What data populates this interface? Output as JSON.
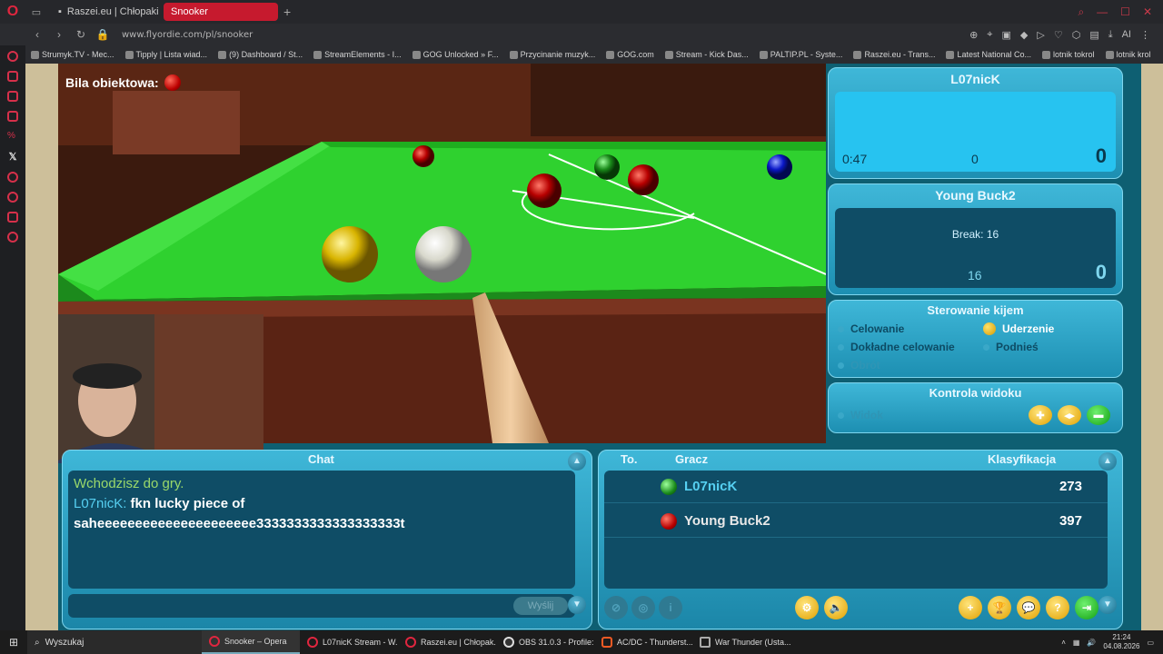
{
  "browser": {
    "tabs": [
      {
        "label": "Raszei.eu | Chłopaki z Raszei",
        "active": false
      },
      {
        "label": "Snooker",
        "active": true
      }
    ],
    "url": "www.flyordie.com/pl/snooker",
    "ai_label": "AI",
    "bookmarks": [
      "Strumyk.TV - Mec...",
      "Tipply | Lista wiad...",
      "(9) Dashboard / St...",
      "StreamElements - I...",
      "GOG Unlocked » F...",
      "Przycinanie muzyk...",
      "GOG.com",
      "Stream - Kick Das...",
      "PALTIP.PL - Syste...",
      "Raszei.eu - Trans...",
      "Latest National Co...",
      "lotnik tokrol",
      "lotnik krol"
    ]
  },
  "game": {
    "object_ball_label": "Bila obiektowa:",
    "players": [
      {
        "name": "L07nicK",
        "time": "0:47",
        "break_pts": "0",
        "score": "0",
        "break_text": ""
      },
      {
        "name": "Young Buck2",
        "time": "",
        "break_pts": "16",
        "score": "0",
        "break_text": "Break: 16"
      }
    ],
    "cue_control": {
      "title": "Sterowanie kijem",
      "options": [
        {
          "label": "Celowanie",
          "state": "normal"
        },
        {
          "label": "Uderzenie",
          "state": "selected"
        },
        {
          "label": "Dokładne celowanie",
          "state": "normal"
        },
        {
          "label": "Podnieś",
          "state": "normal"
        },
        {
          "label": "Obrót",
          "state": "dim"
        }
      ]
    },
    "view_control": {
      "title": "Kontrola widoku",
      "view_label": "Widok"
    },
    "chat": {
      "title": "Chat",
      "system_line": "Wchodzisz do gry.",
      "nick": "L07nicK:",
      "message": "fkn lucky piece of",
      "message2": "saheeeeeeeeeeeeeeeeeeeee3333333333333333333t",
      "send_label": "Wyślij"
    },
    "table": {
      "col_to": "To.",
      "col_player": "Gracz",
      "col_rank": "Klasyfikacja",
      "rows": [
        {
          "name": "L07nicK",
          "rank": "273",
          "ball": "green"
        },
        {
          "name": "Young Buck2",
          "rank": "397",
          "ball": "red"
        }
      ]
    }
  },
  "taskbar": {
    "search": "Wyszukaj",
    "items": [
      "Snooker – Opera",
      "L07nicK Stream - W...",
      "Raszei.eu | Chłopak...",
      "OBS 31.0.3 - Profile:...",
      "AC/DC - Thunderst...",
      "War Thunder (Usta..."
    ],
    "time": "21:24",
    "date": "04.08.2026"
  },
  "colors": {
    "accent_red": "#c61a2e",
    "panel_cyan": "#3fb7d8",
    "table_green": "#2fd12f"
  }
}
